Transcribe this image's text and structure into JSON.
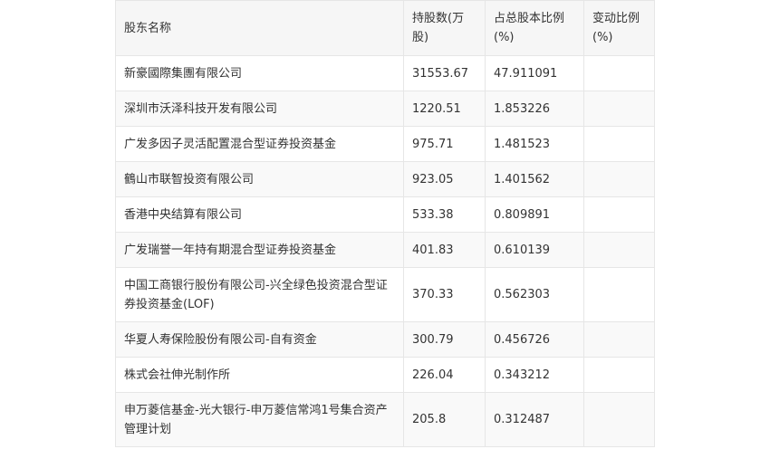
{
  "table": {
    "headers": [
      "股东名称",
      "持股数(万股)",
      "占总股本比例(%)",
      "变动比例(%)"
    ],
    "rows": [
      {
        "name": "新豪國際集團有限公司",
        "shares": "31553.67",
        "ratio": "47.911091",
        "change": ""
      },
      {
        "name": "深圳市沃泽科技开发有限公司",
        "shares": "1220.51",
        "ratio": "1.853226",
        "change": ""
      },
      {
        "name": "广发多因子灵活配置混合型证券投资基金",
        "shares": "975.71",
        "ratio": "1.481523",
        "change": ""
      },
      {
        "name": "鶴山市联智投资有限公司",
        "shares": "923.05",
        "ratio": "1.401562",
        "change": ""
      },
      {
        "name": "香港中央结算有限公司",
        "shares": "533.38",
        "ratio": "0.809891",
        "change": ""
      },
      {
        "name": "广发瑞誉一年持有期混合型证券投资基金",
        "shares": "401.83",
        "ratio": "0.610139",
        "change": ""
      },
      {
        "name": "中国工商银行股份有限公司-兴全绿色投资混合型证券投资基金(LOF)",
        "shares": "370.33",
        "ratio": "0.562303",
        "change": ""
      },
      {
        "name": "华夏人寿保险股份有限公司-自有资金",
        "shares": "300.79",
        "ratio": "0.456726",
        "change": ""
      },
      {
        "name": "株式会社伸光制作所",
        "shares": "226.04",
        "ratio": "0.343212",
        "change": ""
      },
      {
        "name": "申万菱信基金-光大银行-申万菱信常鸿1号集合资产管理计划",
        "shares": "205.8",
        "ratio": "0.312487",
        "change": ""
      }
    ]
  }
}
